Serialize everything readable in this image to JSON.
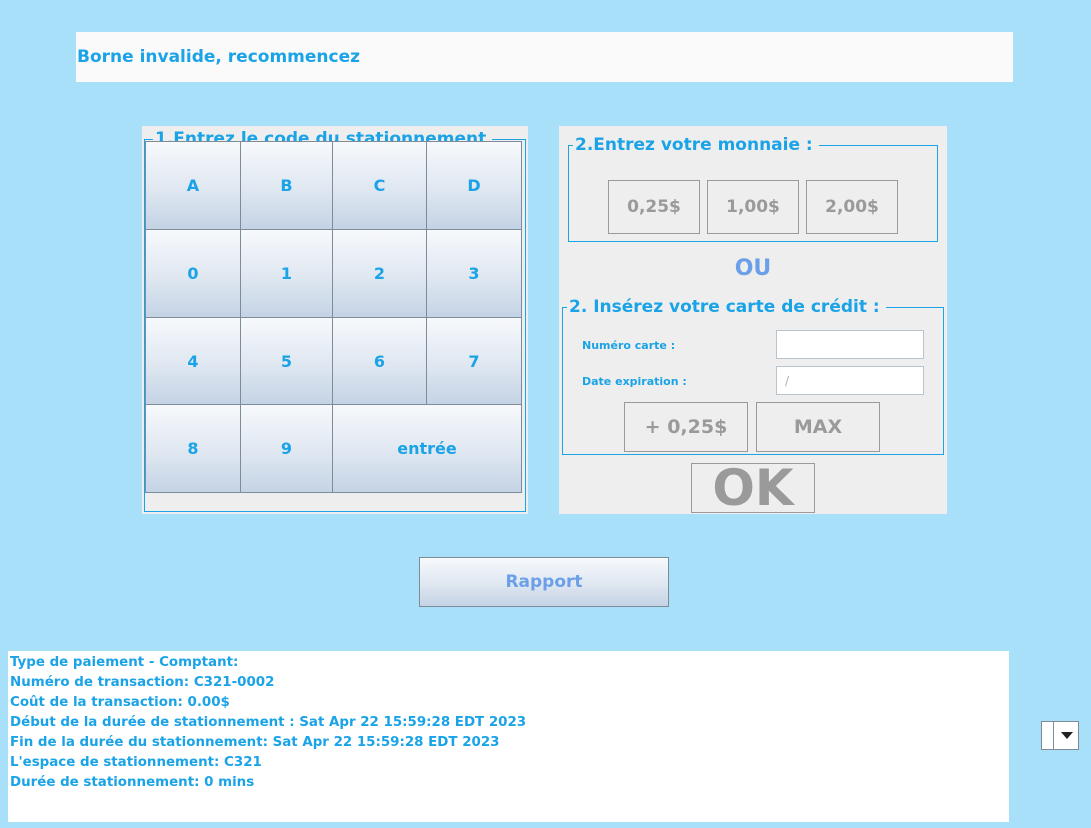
{
  "status": {
    "message": "Borne invalide, recommencez"
  },
  "keypad": {
    "legend": "1.Entrez le code du stationnement",
    "keys": [
      "A",
      "B",
      "C",
      "D",
      "0",
      "1",
      "2",
      "3",
      "4",
      "5",
      "6",
      "7",
      "8",
      "9",
      "entrée"
    ]
  },
  "payment": {
    "money_legend": "2.Entrez votre monnaie :",
    "coins": [
      "0,25$",
      "1,00$",
      "2,00$"
    ],
    "or_label": "OU",
    "card_legend": "2. Insérez votre carte de crédit :",
    "card_number_label": "Numéro  carte :",
    "card_number_value": "",
    "expiry_label": "Date expiration :",
    "expiry_placeholder": "/",
    "add_label": "+ 0,25$",
    "max_label": "MAX",
    "ok_label": "OK"
  },
  "report": {
    "button_label": "Rapport",
    "lines": [
      "Type de paiement - Comptant:",
      "Numéro de transaction: C321-0002",
      "Coût de la transaction: 0.00$",
      "Début de la durée de stationnement : Sat Apr 22 15:59:28 EDT 2023",
      "Fin de la durée du stationnement: Sat Apr 22 15:59:28 EDT 2023",
      "L'espace de stationnement: C321",
      "Durée de stationnement: 0 mins"
    ]
  },
  "dropdown": {
    "icon": "chevron-down-icon"
  },
  "colors": {
    "background": "#a8e0fa",
    "accent": "#1aa3e6",
    "secondary_text": "#6b9fe8",
    "disabled_text": "#9a9a9a"
  }
}
